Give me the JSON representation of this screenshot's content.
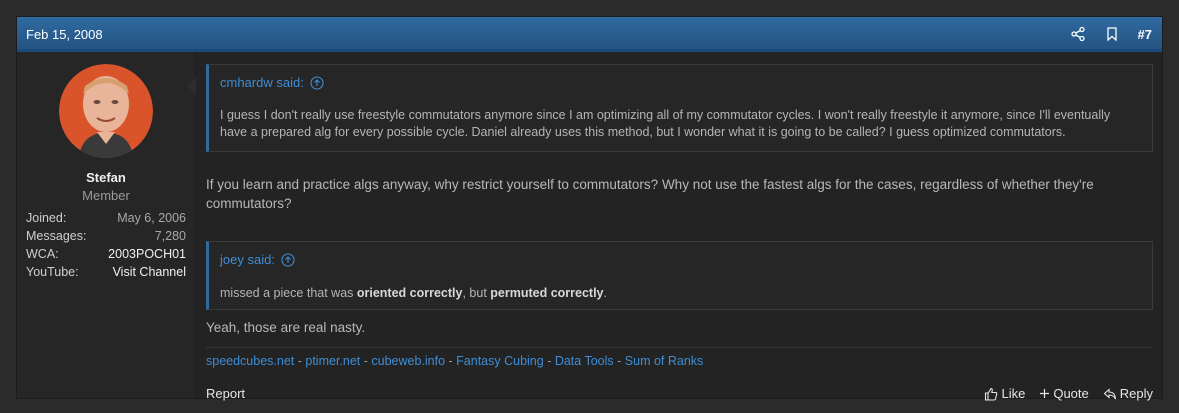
{
  "post": {
    "date": "Feb 15, 2008",
    "number": "#7",
    "share_icon": "share-icon",
    "bookmark_icon": "bookmark-icon"
  },
  "user": {
    "name": "Stefan",
    "title": "Member",
    "info": [
      {
        "label": "Joined:",
        "value": "May 6, 2006"
      },
      {
        "label": "Messages:",
        "value": "7,280"
      },
      {
        "label": "WCA:",
        "value": "2003POCH01"
      },
      {
        "label": "YouTube:",
        "value": "Visit Channel"
      }
    ]
  },
  "quote1": {
    "author": "cmhardw said:",
    "text": "I guess I don't really use freestyle commutators anymore since I am optimizing all of my commutator cycles. I won't really freestyle it anymore, since I'll eventually have a prepared alg for every possible cycle. Daniel already uses this method, but I wonder what it is going to be called? I guess optimized commutators."
  },
  "reply1": "If you learn and practice algs anyway, why restrict yourself to commutators? Why not use the fastest algs for the cases, regardless of whether they're commutators?",
  "quote2": {
    "author": "joey said:",
    "t1": "missed a piece that was ",
    "b1": "oriented correctly",
    "t2": ", but ",
    "b2": "permuted correctly",
    "t3": "."
  },
  "reply2": "Yeah, those are real nasty.",
  "signature": {
    "links": [
      "speedcubes.net",
      "ptimer.net",
      "cubeweb.info",
      "Fantasy Cubing",
      "Data Tools",
      "Sum of Ranks"
    ],
    "separator": " - "
  },
  "footer": {
    "report": "Report",
    "like": "Like",
    "quote": "Quote",
    "reply": "Reply"
  },
  "colors": {
    "header": "#2f6aa1",
    "link": "#3d8ed6"
  }
}
